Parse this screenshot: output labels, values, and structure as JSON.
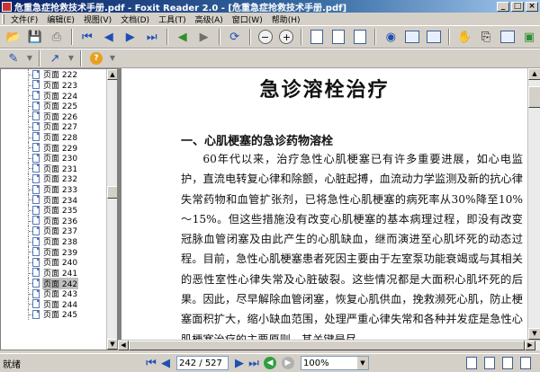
{
  "window": {
    "title": "危重急症抢救技术手册.pdf - Foxit Reader 2.0 - [危重急症抢救技术手册.pdf]"
  },
  "menu": [
    "文件(F)",
    "编辑(E)",
    "视图(V)",
    "文档(D)",
    "工具(T)",
    "高级(A)",
    "窗口(W)",
    "帮助(H)"
  ],
  "tree": {
    "items": [
      "页面 222",
      "页面 223",
      "页面 224",
      "页面 225",
      "页面 226",
      "页面 227",
      "页面 228",
      "页面 229",
      "页面 230",
      "页面 231",
      "页面 232",
      "页面 233",
      "页面 234",
      "页面 235",
      "页面 236",
      "页面 237",
      "页面 238",
      "页面 239",
      "页面 240",
      "页面 241",
      "页面 242",
      "页面 243",
      "页面 244",
      "页面 245"
    ],
    "selected": "页面 242"
  },
  "document": {
    "title": "急诊溶栓治疗",
    "heading": "一、心肌梗塞的急诊药物溶栓",
    "paragraph": "60年代以来，治疗急性心肌梗塞已有许多重要进展，如心电监护，直流电转复心律和除颤，心脏起搏，血流动力学监测及新的抗心律失常药物和血管扩张剂，已将急性心肌梗塞的病死率从30%降至10%～15%。但这些措施没有改变心肌梗塞的基本病理过程，即没有改变冠脉血管闭塞及由此产生的心肌缺血，继而演进至心肌坏死的动态过程。目前，急性心肌梗塞患者死因主要由于左室泵功能衰竭或与其相关的恶性室性心律失常及心脏破裂。这些情况都是大面积心肌坏死的后果。因此，尽早解除血管闭塞，恢复心肌供血，挽救濒死心肌，防止梗塞面积扩大，缩小缺血范围，处理严重心律失常和各种并发症是急性心肌梗塞治疗的主要原则，其关键是尽"
  },
  "status": {
    "text": "就绪",
    "page_display": "242 / 527",
    "zoom": "100%"
  },
  "icons": {
    "toolbar1": [
      "open-icon",
      "save-icon",
      "print-icon",
      "first-page-icon",
      "prev-page-icon",
      "next-page-icon",
      "last-page-icon",
      "go-back-icon",
      "go-forward-icon",
      "rotate-icon",
      "zoom-out-icon",
      "zoom-in-icon",
      "single-page-icon",
      "continuous-icon",
      "facing-icon",
      "find-icon",
      "list-icon",
      "fit-page-icon",
      "hand-tool-icon",
      "select-text-icon",
      "snapshot-icon",
      "image-icon"
    ],
    "toolbar2": [
      "annotation-icon",
      "arrow-tool-icon",
      "help-icon"
    ]
  }
}
